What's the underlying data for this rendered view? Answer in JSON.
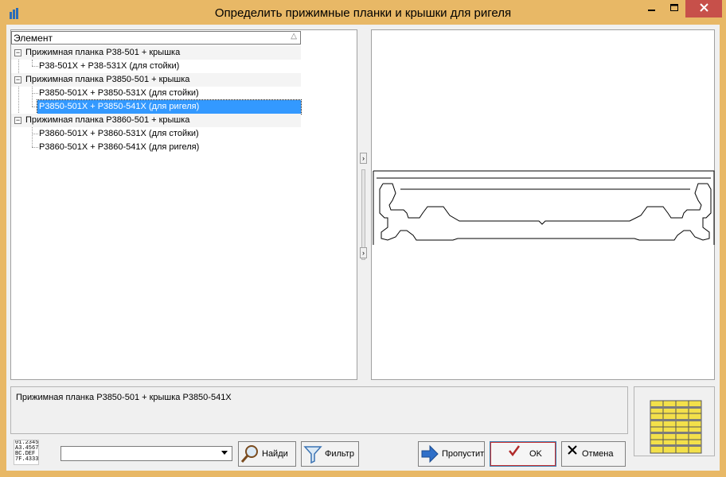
{
  "window": {
    "title": "Определить прижимные планки и крышки для ригеля"
  },
  "tree": {
    "column_header": "Элемент",
    "groups": [
      {
        "label": "Прижимная планка Р38-501 + крышка",
        "expanded": true,
        "children": [
          "Р38-501X + Р38-531X (для стойки)"
        ]
      },
      {
        "label": "Прижимная планка Р3850-501 + крышка",
        "expanded": true,
        "children": [
          "Р3850-501X + Р3850-531X (для стойки)",
          "Р3850-501X + Р3850-541X (для ригеля)"
        ]
      },
      {
        "label": "Прижимная планка Р3860-501 + крышка",
        "expanded": true,
        "children": [
          "Р3860-501X + Р3860-531X (для стойки)",
          "Р3860-501X + Р3860-541X (для ригеля)"
        ]
      }
    ],
    "selected": "Р3850-501X + Р3850-541X (для ригеля)"
  },
  "description": "Прижимная планка Р3850-501 + крышка Р3850-541X",
  "toolbar": {
    "format_icon_text": [
      "01.2345",
      "A3.4567",
      "BC.DEF",
      "7F.4333"
    ],
    "combo_value": "",
    "find_label": "Найди",
    "filter_label": "Фильтр",
    "skip_label": "Пропустит",
    "ok_label": "OK",
    "cancel_label": "Отмена"
  },
  "colors": {
    "title_bar": "#e8b866",
    "close_button": "#c7504a",
    "selection": "#3399ff",
    "thumb_fill": "#f3e04a"
  },
  "icons": {
    "app": "app-bars-icon",
    "minimize": "minimize-icon",
    "maximize": "maximize-icon",
    "close": "close-icon",
    "find": "magnifier-icon",
    "filter": "funnel-icon",
    "skip": "arrow-right-icon",
    "ok": "checkmark-icon",
    "cancel": "x-icon"
  }
}
